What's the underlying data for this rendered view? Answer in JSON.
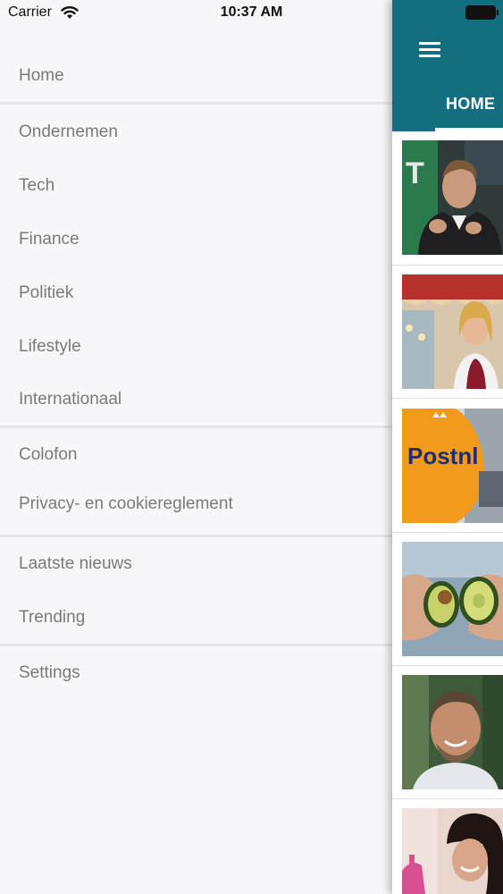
{
  "status_bar": {
    "carrier": "Carrier",
    "time": "10:37 AM"
  },
  "drawer": {
    "items": [
      {
        "label": "Home"
      },
      {
        "label": "Ondernemen"
      },
      {
        "label": "Tech"
      },
      {
        "label": "Finance"
      },
      {
        "label": "Politiek"
      },
      {
        "label": "Lifestyle"
      },
      {
        "label": "Internationaal"
      },
      {
        "label": "Colofon"
      },
      {
        "label": "Privacy- en cookiereglement"
      },
      {
        "label": "Laatste nieuws"
      },
      {
        "label": "Trending"
      },
      {
        "label": "Settings"
      }
    ]
  },
  "main": {
    "tab_label": "HOME",
    "accent_color": "#136e80",
    "thumbnails": [
      {
        "alt_icon": "photo-man-speaking"
      },
      {
        "alt_icon": "photo-woman-carousel"
      },
      {
        "alt_icon": "photo-postnl-vehicle",
        "text": "Postnl"
      },
      {
        "alt_icon": "photo-avocado-halves"
      },
      {
        "alt_icon": "photo-smiling-man"
      },
      {
        "alt_icon": "photo-woman-smiling"
      }
    ]
  }
}
